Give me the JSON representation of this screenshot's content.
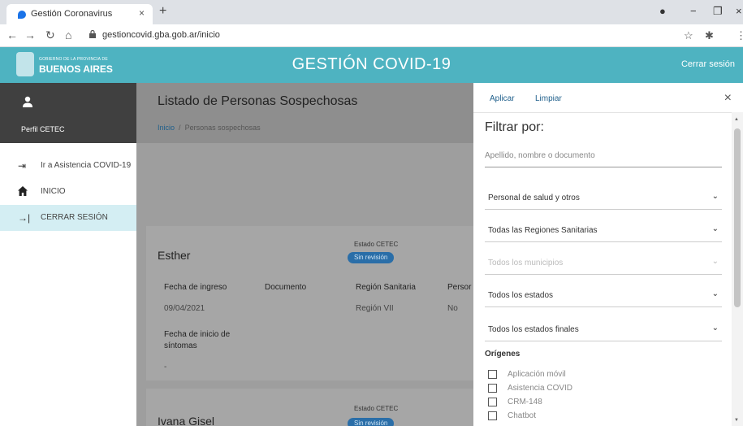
{
  "browser": {
    "tab_title": "Gestión Coronavirus",
    "tab_close": "×",
    "new_tab": "+",
    "url": "gestioncovid.gba.gob.ar/inicio"
  },
  "header": {
    "logo_small": "GOBIERNO DE LA PROVINCIA DE",
    "logo_big": "BUENOS AIRES",
    "title": "GESTIÓN COVID-19",
    "logout": "Cerrar sesión"
  },
  "sidebar": {
    "profile": "Perfil CETEC",
    "items": [
      {
        "label": "Ir a Asistencia COVID-19",
        "icon": "login-icon"
      },
      {
        "label": "INICIO",
        "icon": "home-icon"
      },
      {
        "label": "CERRAR SESIÓN",
        "icon": "logout-icon"
      }
    ]
  },
  "main": {
    "page_title": "Listado de Personas Sospechosas",
    "breadcrumb_home": "Inicio",
    "breadcrumb_sep": "/",
    "breadcrumb_current": "Personas sospechosas",
    "cards": [
      {
        "name": "Esther",
        "estado_label": "Estado CETEC",
        "estado": "Sin revisión",
        "fields": {
          "fecha_ingreso_label": "Fecha de ingreso",
          "fecha_ingreso": "09/04/2021",
          "documento_label": "Documento",
          "region_label": "Región Sanitaria",
          "region": "Región VII",
          "persona_label": "Persor",
          "persona": "No",
          "inicio_label_1": "Fecha de inicio de",
          "inicio_label_2": "síntomas",
          "inicio": "-"
        }
      },
      {
        "name": "Ivana Gisel",
        "estado_label": "Estado CETEC",
        "estado": "Sin revisión"
      }
    ]
  },
  "filter": {
    "apply": "Aplicar",
    "clear": "Limpiar",
    "close": "×",
    "heading": "Filtrar por:",
    "search_placeholder": "Apellido, nombre o documento",
    "selects": [
      {
        "value": "Personal de salud y otros",
        "disabled": false
      },
      {
        "value": "Todas las Regiones Sanitarias",
        "disabled": false
      },
      {
        "value": "Todos los municipios",
        "disabled": true
      },
      {
        "value": "Todos los estados",
        "disabled": false
      },
      {
        "value": "Todos los estados finales",
        "disabled": false
      }
    ],
    "origins_title": "Orígenes",
    "origins": [
      "Aplicación móvil",
      "Asistencia COVID",
      "CRM-148",
      "Chatbot"
    ]
  },
  "colors": {
    "header_bg": "#4eb3c1",
    "badge_bg": "#2a6ea8",
    "link": "#1f5f8b"
  }
}
